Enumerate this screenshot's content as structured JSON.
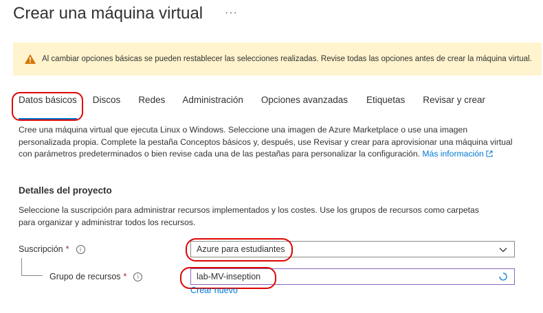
{
  "page": {
    "title": "Crear una máquina virtual",
    "more_label": "···"
  },
  "banner": {
    "icon": "warning-icon",
    "text": "Al cambiar opciones básicas se pueden restablecer las selecciones realizadas. Revise todas las opciones antes de crear la máquina virtual."
  },
  "tabs": [
    {
      "label": "Datos básicos",
      "active": true
    },
    {
      "label": "Discos"
    },
    {
      "label": "Redes"
    },
    {
      "label": "Administración"
    },
    {
      "label": "Opciones avanzadas"
    },
    {
      "label": "Etiquetas"
    },
    {
      "label": "Revisar y crear"
    }
  ],
  "intro": {
    "text": "Cree una máquina virtual que ejecuta Linux o Windows. Seleccione una imagen de Azure Marketplace o use una imagen personalizada propia. Complete la pestaña Conceptos básicos y, después, use Revisar y crear para aprovisionar una máquina virtual con parámetros predeterminados o bien revise cada una de las pestañas para personalizar la configuración.",
    "link": "Más información"
  },
  "project": {
    "heading": "Detalles del proyecto",
    "description": "Seleccione la suscripción para administrar recursos implementados y los costes. Use los grupos de recursos como carpetas para organizar y administrar todos los recursos.",
    "subscription_label": "Suscripción",
    "subscription_value": "Azure para estudiantes",
    "resource_group_label": "Grupo de recursos",
    "resource_group_value": "lab-MV-inseption",
    "create_new": "Crear nuevo",
    "required_mark": "*"
  },
  "colors": {
    "accent": "#0078d4",
    "warning_bg": "#fff4ce",
    "annotation_red": "#e00000",
    "focus_purple": "#8764b8"
  }
}
